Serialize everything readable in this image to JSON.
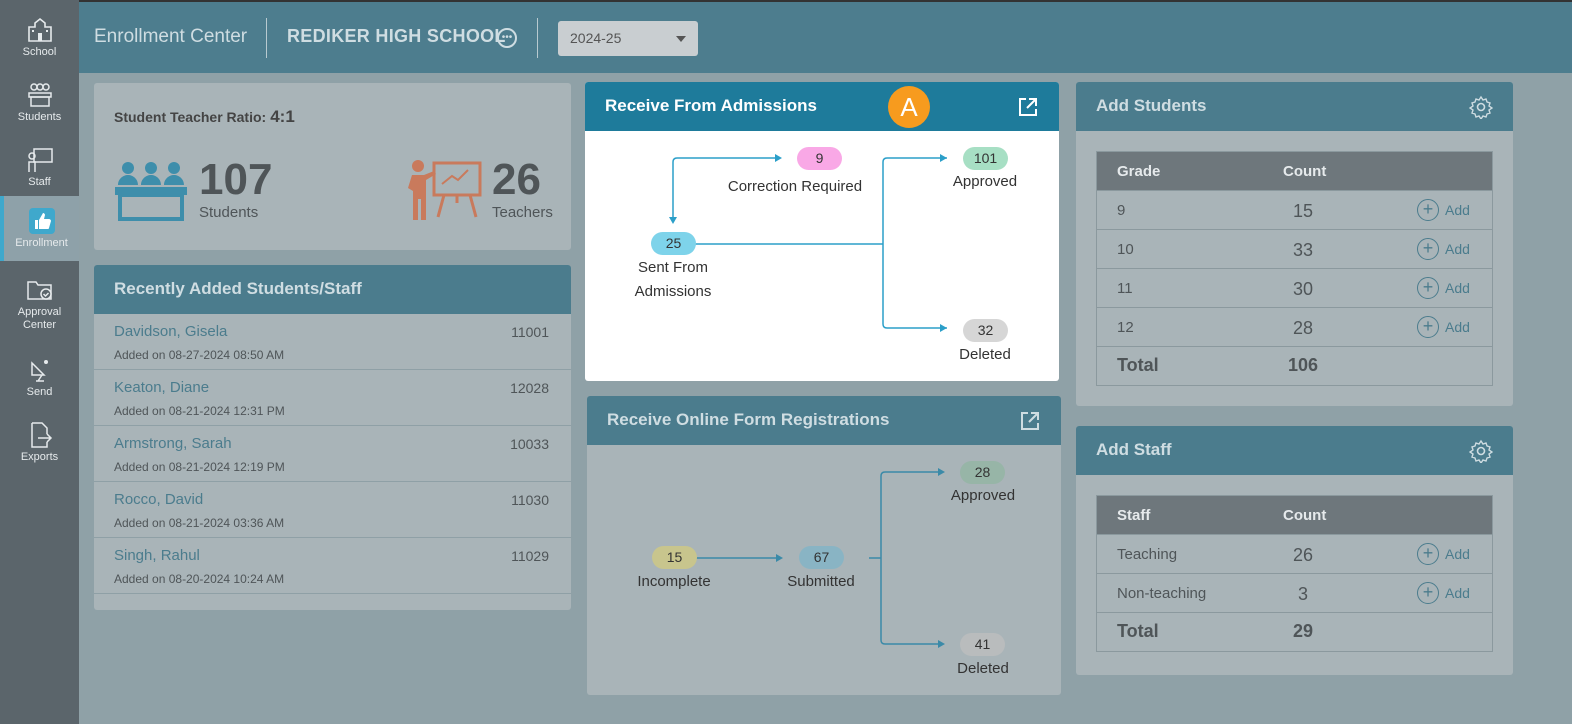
{
  "sidebar": {
    "items": [
      {
        "label": "School",
        "icon": "school-icon"
      },
      {
        "label": "Students",
        "icon": "students-icon"
      },
      {
        "label": "Staff",
        "icon": "staff-icon"
      },
      {
        "label": "Enrollment",
        "icon": "thumbs-up-icon",
        "active": true
      },
      {
        "label": "Approval Center",
        "icon": "folder-check-icon"
      },
      {
        "label": "Send",
        "icon": "satellite-dish-icon"
      },
      {
        "label": "Exports",
        "icon": "export-file-icon"
      }
    ]
  },
  "header": {
    "app_title": "Enrollment Center",
    "school_name": "REDIKER HIGH SCHOOL",
    "school_more_icon": "ellipsis-icon",
    "year": "2024-25"
  },
  "ratio": {
    "label": "Student Teacher Ratio:",
    "value": "4:1",
    "students_count": "107",
    "students_label": "Students",
    "teachers_count": "26",
    "teachers_label": "Teachers"
  },
  "recent": {
    "title": "Recently Added Students/Staff",
    "rows": [
      {
        "name": "Davidson, Gisela",
        "date": "Added on 08-27-2024 08:50 AM",
        "id": "11001"
      },
      {
        "name": "Keaton, Diane",
        "date": "Added on 08-21-2024 12:31 PM",
        "id": "12028"
      },
      {
        "name": "Armstrong, Sarah",
        "date": "Added on 08-21-2024 12:19 PM",
        "id": "10033"
      },
      {
        "name": "Rocco, David",
        "date": "Added on 08-21-2024 03:36 AM",
        "id": "11030"
      },
      {
        "name": "Singh, Rahul",
        "date": "Added on 08-20-2024 10:24 AM",
        "id": "11029"
      }
    ]
  },
  "admissions": {
    "title": "Receive From Admissions",
    "badge": "A",
    "correction_count": "9",
    "correction_label": "Correction Required",
    "approved_count": "101",
    "approved_label": "Approved",
    "sent_count": "25",
    "sent_label_1": "Sent From",
    "sent_label_2": "Admissions",
    "deleted_count": "32",
    "deleted_label": "Deleted"
  },
  "online": {
    "title": "Receive Online Form Registrations",
    "approved_count": "28",
    "approved_label": "Approved",
    "incomplete_count": "15",
    "incomplete_label": "Incomplete",
    "submitted_count": "67",
    "submitted_label": "Submitted",
    "deleted_count": "41",
    "deleted_label": "Deleted"
  },
  "add_students": {
    "title": "Add Students",
    "col1": "Grade",
    "col2": "Count",
    "add_label": "Add",
    "rows": [
      {
        "grade": "9",
        "count": "15"
      },
      {
        "grade": "10",
        "count": "33"
      },
      {
        "grade": "11",
        "count": "30"
      },
      {
        "grade": "12",
        "count": "28"
      }
    ],
    "total_label": "Total",
    "total": "106"
  },
  "add_staff": {
    "title": "Add Staff",
    "col1": "Staff",
    "col2": "Count",
    "add_label": "Add",
    "rows": [
      {
        "type": "Teaching",
        "count": "26"
      },
      {
        "type": "Non-teaching",
        "count": "3"
      }
    ],
    "total_label": "Total",
    "total": "29"
  },
  "colors": {
    "header": "#4d7d8e",
    "sidebar": "#5b656b",
    "active_head": "#1e7b9b",
    "badge": "#f79b1e",
    "pill_blue": "#7ed3ea",
    "pill_pink": "#f9a8e6",
    "pill_green": "#a7dfc4",
    "pill_grey": "#d6d6d6"
  }
}
